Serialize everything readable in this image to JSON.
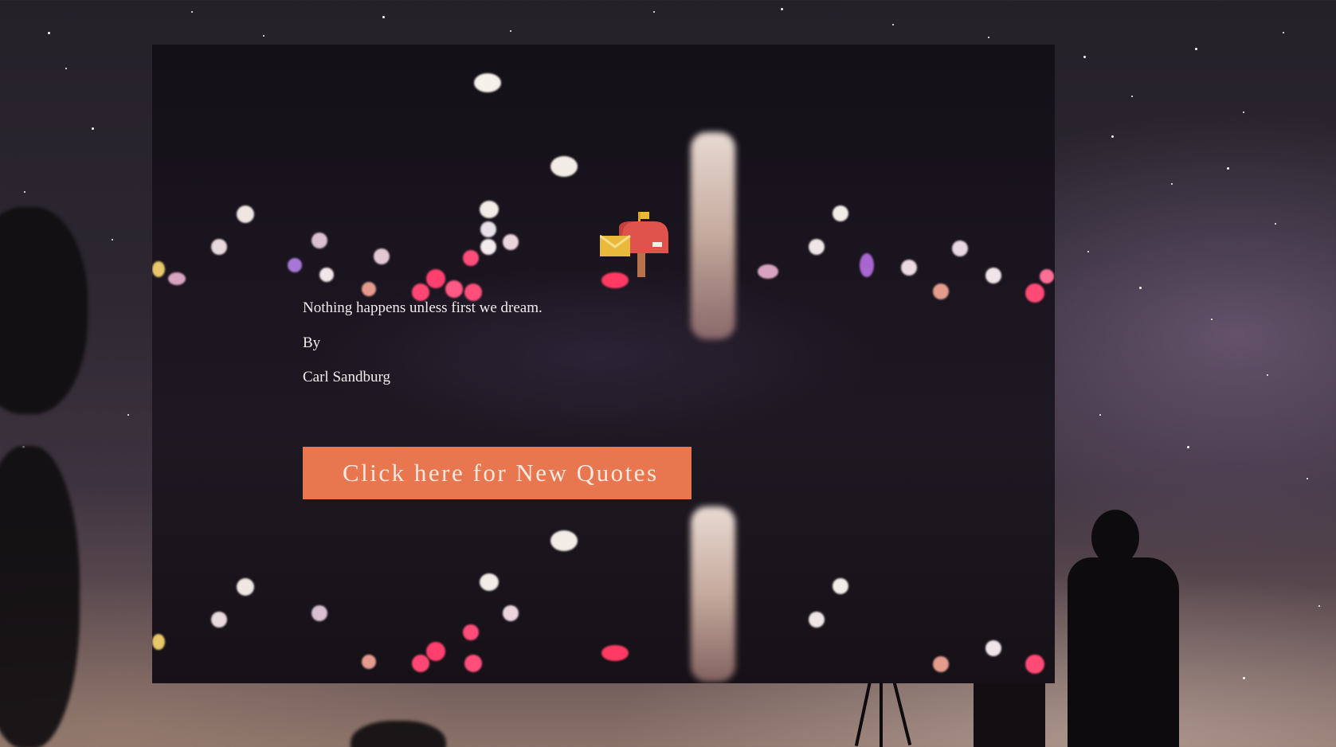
{
  "quote": {
    "text": "Nothing happens unless first we dream.",
    "by_label": "By",
    "author": "Carl Sandburg"
  },
  "button": {
    "label": "Click here for New Quotes"
  },
  "icons": {
    "mailbox": "mailbox-icon"
  },
  "colors": {
    "button_bg": "#e8774f",
    "button_text": "#fbe9e2",
    "text": "#f3ecec",
    "card_bg": "#1b1520"
  }
}
